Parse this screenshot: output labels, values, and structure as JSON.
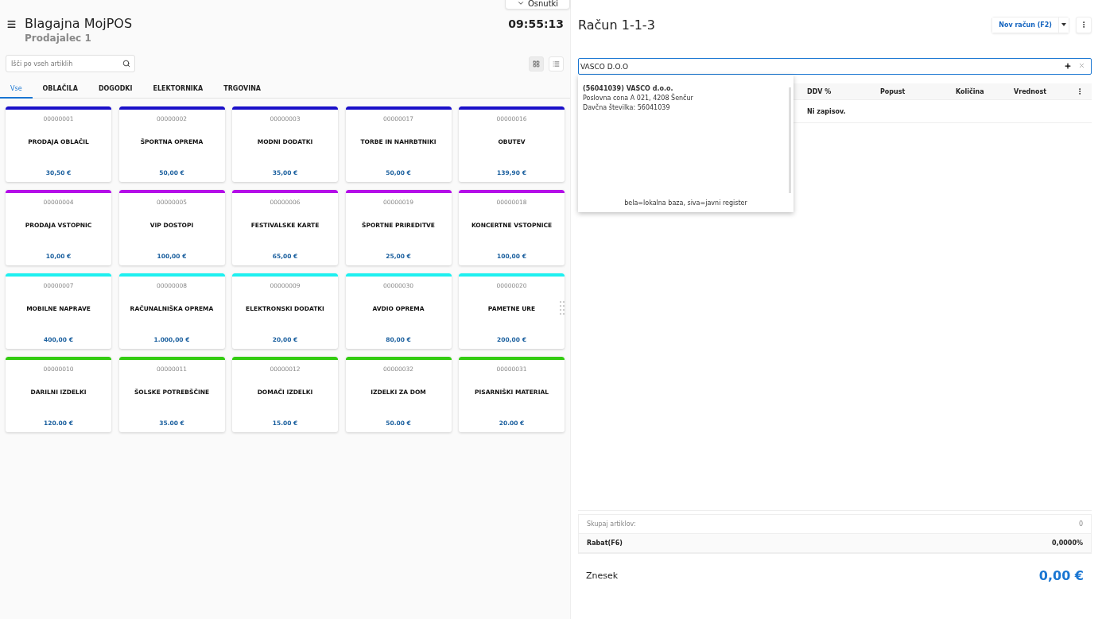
{
  "drafts_button": {
    "label": "Osnutki"
  },
  "header": {
    "title": "Blagajna MojPOS",
    "subtitle": "Prodajalec 1",
    "clock": "09:55:13"
  },
  "search": {
    "placeholder": "Išči po vseh artiklih"
  },
  "view_toggle": [
    {
      "kind": "grid",
      "selected": true
    },
    {
      "kind": "list",
      "selected": false
    }
  ],
  "tabs": [
    {
      "label": "Vse",
      "selected": true
    },
    {
      "label": "OBLAČILA",
      "selected": false
    },
    {
      "label": "DOGODKI",
      "selected": false
    },
    {
      "label": "ELEKTORNIKA",
      "selected": false
    },
    {
      "label": "TRGOVINA",
      "selected": false
    }
  ],
  "products": [
    {
      "code": "00000001",
      "name": "PRODAJA OBLAČIL",
      "price": "30,50 €",
      "color": "#1a0fc9"
    },
    {
      "code": "00000002",
      "name": "ŠPORTNA OPREMA",
      "price": "50,00 €",
      "color": "#1a0fc9"
    },
    {
      "code": "00000003",
      "name": "MODNI DODATKI",
      "price": "35,00 €",
      "color": "#1a0fc9"
    },
    {
      "code": "00000017",
      "name": "TORBE IN NAHRBTNIKI",
      "price": "50,00 €",
      "color": "#1a0fc9"
    },
    {
      "code": "00000016",
      "name": "OBUTEV",
      "price": "139,90 €",
      "color": "#1a0fc9"
    },
    {
      "code": "00000004",
      "name": "PRODAJA VSTOPNIC",
      "price": "10,00 €",
      "color": "#b40ee8"
    },
    {
      "code": "00000005",
      "name": "VIP DOSTOPI",
      "price": "100,00 €",
      "color": "#b40ee8"
    },
    {
      "code": "00000006",
      "name": "FESTIVALSKE KARTE",
      "price": "65,00 €",
      "color": "#b40ee8"
    },
    {
      "code": "00000019",
      "name": "ŠPORTNE PRIREDITVE",
      "price": "25,00 €",
      "color": "#b40ee8"
    },
    {
      "code": "00000018",
      "name": "KONCERTNE VSTOPNICE",
      "price": "100,00 €",
      "color": "#b40ee8"
    },
    {
      "code": "00000007",
      "name": "MOBILNE NAPRAVE",
      "price": "400,00 €",
      "color": "#1ef0f0"
    },
    {
      "code": "00000008",
      "name": "RAČUNALNIŠKA OPREMA",
      "price": "1.000,00 €",
      "color": "#1ef0f0"
    },
    {
      "code": "00000009",
      "name": "ELEKTRONSKI DODATKI",
      "price": "20,00 €",
      "color": "#1ef0f0"
    },
    {
      "code": "00000030",
      "name": "AVDIO OPREMA",
      "price": "80,00 €",
      "color": "#1ef0f0"
    },
    {
      "code": "00000020",
      "name": "PAMETNE URE",
      "price": "200,00 €",
      "color": "#1ef0f0"
    },
    {
      "code": "00000010",
      "name": "DARILNI IZDELKI",
      "price": "120.00 €",
      "color": "#33cc11"
    },
    {
      "code": "00000011",
      "name": "ŠOLSKE POTREBŠČINE",
      "price": "35.00 €",
      "color": "#33cc11"
    },
    {
      "code": "00000012",
      "name": "DOMAČI IZDELKI",
      "price": "15.00 €",
      "color": "#33cc11"
    },
    {
      "code": "00000032",
      "name": "IZDELKI ZA DOM",
      "price": "50.00 €",
      "color": "#33cc11"
    },
    {
      "code": "00000031",
      "name": "PISARNIŠKI MATERIAL",
      "price": "20.00 €",
      "color": "#33cc11"
    }
  ],
  "invoice": {
    "title": "Račun 1-1-3",
    "new_button": "Nov račun (F2)",
    "customer_field": {
      "value": "VASCO D.O.O"
    },
    "customer_suggestions": [
      {
        "lines": [
          "**(56041039) VASCO d.o.o.**",
          "Poslovna cona A 021, 4208 Šenčur",
          "Davčna številka: 56041039"
        ]
      }
    ],
    "suggestion_legend": "bela=lokalna baza, siva=javni register",
    "table": {
      "columns": [
        "DDV %",
        "Popust",
        "Količina",
        "Vrednost"
      ],
      "empty_text": "Ni zapisov."
    },
    "summary": [
      {
        "label": "Skupaj artiklov:",
        "value": "0",
        "bold": false
      },
      {
        "label": "Rabat(F6)",
        "value": "0,0000%",
        "bold": true
      }
    ],
    "total": {
      "label": "Znesek",
      "value": "0,00 €"
    }
  }
}
